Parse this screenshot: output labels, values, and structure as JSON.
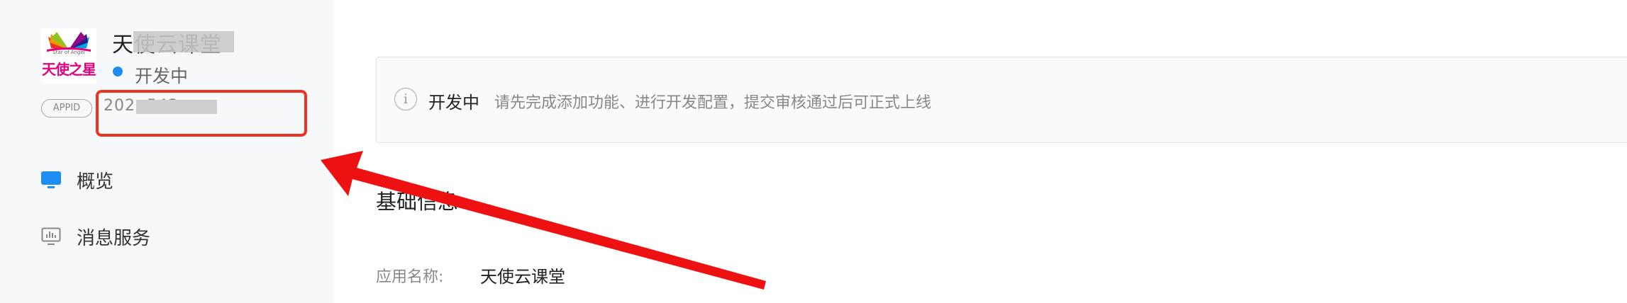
{
  "sidebar": {
    "logo": {
      "text": "天使之星",
      "subtext": "Star of Angel"
    },
    "app_name": "天使云课堂",
    "status": {
      "text": "开发中",
      "color": "#1e8cf0"
    },
    "appid": {
      "badge": "APPID",
      "value": "202              .543"
    },
    "nav": [
      {
        "label": "概览",
        "icon": "monitor-icon",
        "active": true
      },
      {
        "label": "消息服务",
        "icon": "chart-board-icon",
        "active": false
      }
    ]
  },
  "main": {
    "notice": {
      "icon": "i",
      "title": "开发中",
      "description": "请先完成添加功能、进行开发配置，提交审核通过后可正式上线"
    },
    "section_title": "基础信息",
    "fields": [
      {
        "label": "应用名称:",
        "value": "天使云课堂"
      }
    ]
  },
  "annotation": {
    "arrow_color": "#ee1111",
    "highlight_color": "#ee3322"
  }
}
